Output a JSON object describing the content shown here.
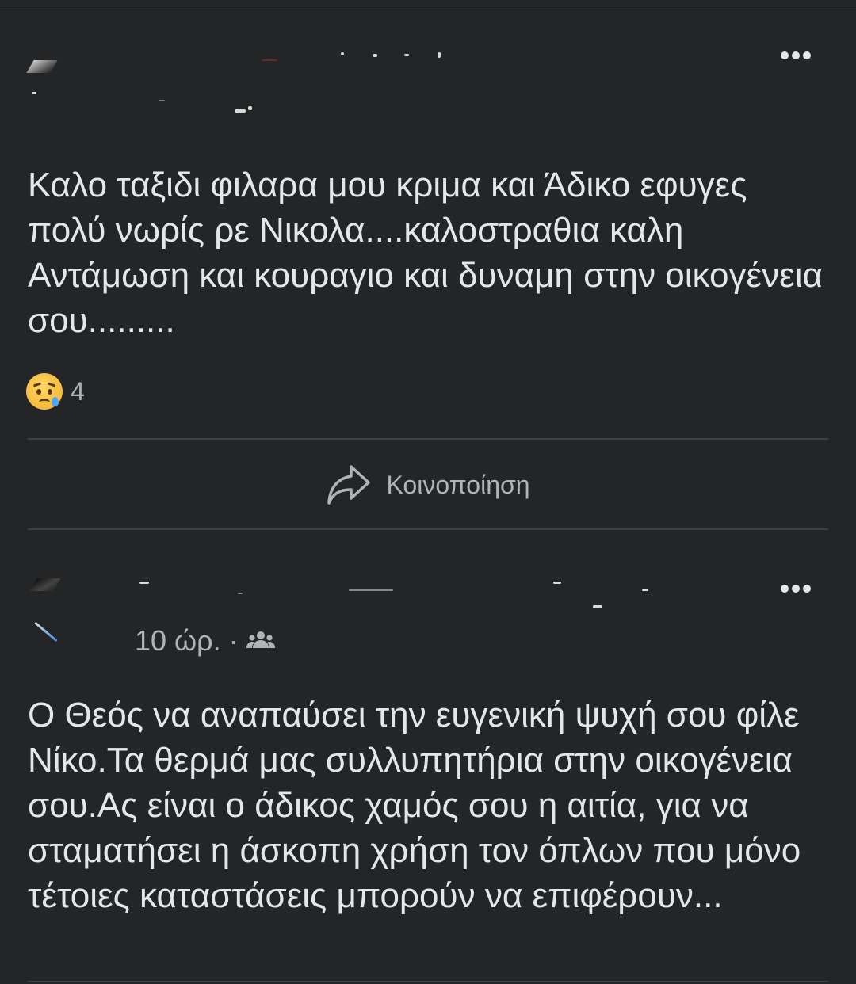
{
  "post1": {
    "body": "Καλο ταξιδι φιλαρα μου κριμα και Άδικο εφυγες πολύ νωρίς ρε Νικολα....καλοστραθια καλη Αντάμωση και κουραγιο και δυναμη στην οικογένεια σου.........",
    "reaction": {
      "icon": "sad-face-icon",
      "count": "4"
    },
    "share_label": "Κοινοποίηση"
  },
  "post2": {
    "time": "10 ώρ.",
    "separator": "·",
    "audience_icon": "friends-icon",
    "body": "Ο Θεός να αναπαύσει την ευγενική ψυχή σου φίλε Νίκο.Τα θερμά μας συλλυπητήρια στην οικογένεια σου.Ας είναι ο άδικος χαμός σου η αιτία, για να σταματήσει η άσκοπη χρήση τον όπλων που μόνο τέτοιες καταστάσεις μπορούν να επιφέρουν..."
  },
  "colors": {
    "background": "#242526",
    "text": "#e4e6eb",
    "secondary_text": "#b0b3b8",
    "divider": "#3e4042"
  }
}
